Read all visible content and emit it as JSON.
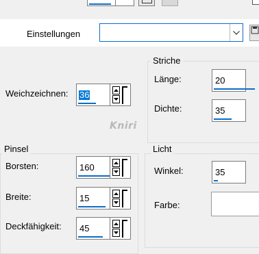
{
  "top": {
    "preset_label": "Einstellungen",
    "preset_value": ""
  },
  "strokes": {
    "title": "Striche",
    "length_label": "Länge:",
    "length_value": "20",
    "density_label": "Dichte:",
    "density_value": "35"
  },
  "softness": {
    "label": "Weichzeichnen:",
    "value": "36"
  },
  "signature": "Kniri",
  "brush": {
    "title": "Pinsel",
    "bristles_label": "Borsten:",
    "bristles_value": "160",
    "width_label": "Breite:",
    "width_value": "15",
    "opacity_label": "Deckfähigkeit:",
    "opacity_value": "45"
  },
  "light": {
    "title": "Licht",
    "angle_label": "Winkel:",
    "angle_value": "35",
    "color_label": "Farbe:",
    "color_value": "#ffffff"
  },
  "colors": {
    "accent": "#0b6cc7",
    "selection": "#0078d7",
    "background": "#f0f0f0"
  }
}
